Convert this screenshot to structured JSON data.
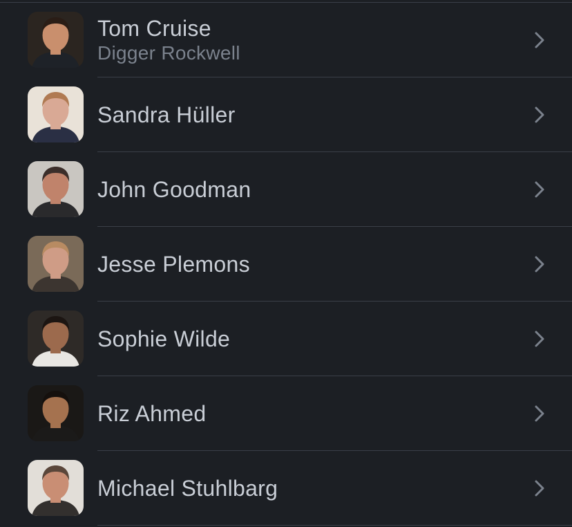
{
  "cast": [
    {
      "actor": "Tom Cruise",
      "character": "Digger Rockwell",
      "avatar": {
        "bg": "#2b2520",
        "skin": "#c98f6d",
        "hair": "#2a1d16",
        "shirt": "#1e2228"
      }
    },
    {
      "actor": "Sandra Hüller",
      "character": "",
      "avatar": {
        "bg": "#e9e2d8",
        "skin": "#d9a995",
        "hair": "#b07a52",
        "shirt": "#2a2f44"
      }
    },
    {
      "actor": "John Goodman",
      "character": "",
      "avatar": {
        "bg": "#c9c6c1",
        "skin": "#c0836b",
        "hair": "#3b2e2a",
        "shirt": "#2a2a2c"
      }
    },
    {
      "actor": "Jesse Plemons",
      "character": "",
      "avatar": {
        "bg": "#7a6a58",
        "skin": "#cf9c86",
        "hair": "#b88b62",
        "shirt": "#3c3530"
      }
    },
    {
      "actor": "Sophie Wilde",
      "character": "",
      "avatar": {
        "bg": "#2e2a27",
        "skin": "#9c6a4d",
        "hair": "#1c1512",
        "shirt": "#e8e6e2"
      }
    },
    {
      "actor": "Riz Ahmed",
      "character": "",
      "avatar": {
        "bg": "#1a1816",
        "skin": "#a5724f",
        "hair": "#15100d",
        "shirt": "#1b1a19"
      }
    },
    {
      "actor": "Michael Stuhlbarg",
      "character": "",
      "avatar": {
        "bg": "#e2ded8",
        "skin": "#c98e74",
        "hair": "#5a463a",
        "shirt": "#33302e"
      }
    }
  ],
  "icons": {
    "row_chevron": "chevron-right-icon"
  },
  "colors": {
    "background": "#1c1f24",
    "divider": "#3a3f48",
    "primary_text": "#c9ced6",
    "secondary_text": "#7b828d",
    "chevron": "#7b828d"
  }
}
